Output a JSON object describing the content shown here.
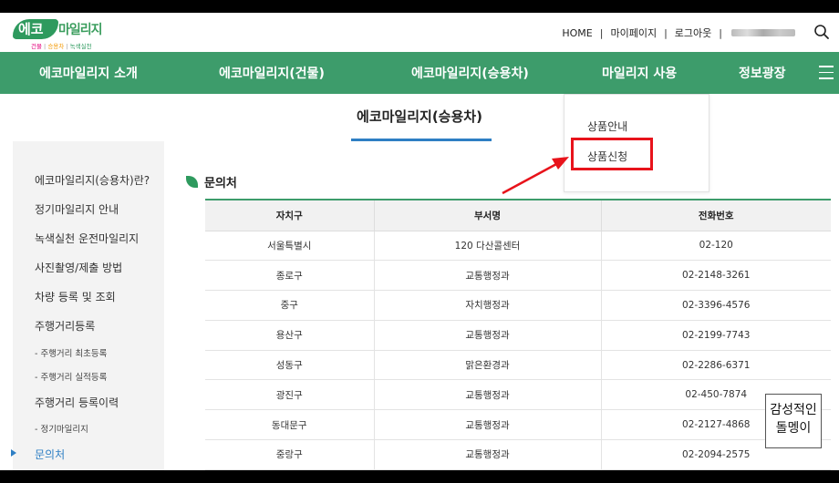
{
  "logo": {
    "main1": "에코",
    "main2": "마일리지",
    "sub1": "건물",
    "sub2": "승용차",
    "sub3": "녹색실천",
    "sep": "|"
  },
  "util": {
    "home": "HOME",
    "mypage": "마이페이지",
    "logout": "로그아웃",
    "sep": "|"
  },
  "nav": {
    "items": [
      "에코마일리지 소개",
      "에코마일리지(건물)",
      "에코마일리지(승용차)",
      "마일리지 사용",
      "정보광장"
    ]
  },
  "page_title": "에코마일리지(승용차)",
  "dropdown": {
    "items": [
      "상품안내",
      "상품신청"
    ]
  },
  "sidebar": {
    "items": [
      {
        "label": "에코마일리지(승용차)란?",
        "type": "main"
      },
      {
        "label": "정기마일리지 안내",
        "type": "main"
      },
      {
        "label": "녹색실천 운전마일리지",
        "type": "main"
      },
      {
        "label": "사진촬영/제출 방법",
        "type": "main"
      },
      {
        "label": "차량 등록 및 조회",
        "type": "main"
      },
      {
        "label": "주행거리등록",
        "type": "main"
      },
      {
        "label": "- 주행거리 최초등록",
        "type": "sub"
      },
      {
        "label": "- 주행거리 실적등록",
        "type": "sub"
      },
      {
        "label": "주행거리 등록이력",
        "type": "main"
      },
      {
        "label": "- 정기마일리지",
        "type": "sub"
      },
      {
        "label": "문의처",
        "type": "active"
      }
    ]
  },
  "section_title": "문의처",
  "table": {
    "headers": [
      "자치구",
      "부서명",
      "전화번호"
    ],
    "rows": [
      [
        "서울특별시",
        "120 다산콜센터",
        "02-120"
      ],
      [
        "종로구",
        "교통행정과",
        "02-2148-3261"
      ],
      [
        "중구",
        "자치행정과",
        "02-3396-4576"
      ],
      [
        "용산구",
        "교통행정과",
        "02-2199-7743"
      ],
      [
        "성동구",
        "맑은환경과",
        "02-2286-6371"
      ],
      [
        "광진구",
        "교통행정과",
        "02-450-7874"
      ],
      [
        "동대문구",
        "교통행정과",
        "02-2127-4868"
      ],
      [
        "중랑구",
        "교통행정과",
        "02-2094-2575"
      ]
    ]
  },
  "stamp": {
    "line1": "감성적인",
    "line2": "돌멩이"
  },
  "colors": {
    "nav_green": "#3d9c6b",
    "accent_blue": "#2e7fc4",
    "highlight_red": "#e8131b"
  }
}
